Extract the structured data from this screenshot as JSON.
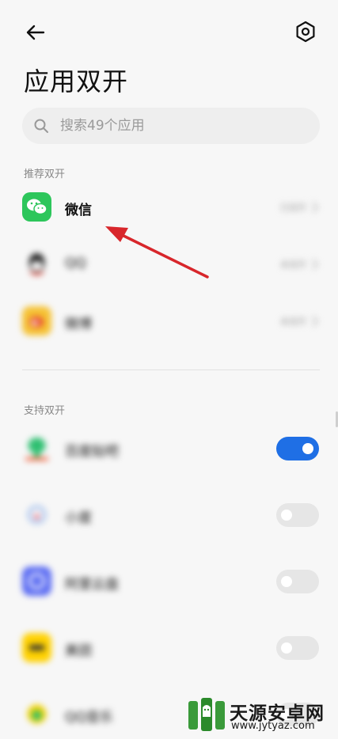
{
  "header": {
    "title": "应用双开"
  },
  "search": {
    "placeholder": "搜索49个应用"
  },
  "sections": {
    "recommended_label": "推荐双开",
    "supported_label": "支持双开"
  },
  "recommended": [
    {
      "name": "微信",
      "status": "已双开",
      "icon_color": "#2dc65b"
    },
    {
      "name": "QQ",
      "status": "未双开",
      "icon_color": "#222222"
    },
    {
      "name": "微博",
      "status": "未双开",
      "icon_color": "#f5c234"
    }
  ],
  "supported": [
    {
      "name": "百度贴吧",
      "toggle_on": true,
      "icon_color": "#2fbf71"
    },
    {
      "name": "小度",
      "toggle_on": false,
      "icon_color": "#d9e6f7"
    },
    {
      "name": "阿里云盘",
      "toggle_on": false,
      "icon_color": "#5a6bf2"
    },
    {
      "name": "美团",
      "toggle_on": false,
      "icon_color": "#ffd100"
    },
    {
      "name": "QQ音乐",
      "toggle_on": false,
      "icon_color": "#f3d100"
    }
  ],
  "colors": {
    "accent": "#1f6fe5",
    "annotation_arrow": "#d8262b"
  },
  "watermark": {
    "title": "天源安卓网",
    "url": "www.jytyaz.com"
  }
}
